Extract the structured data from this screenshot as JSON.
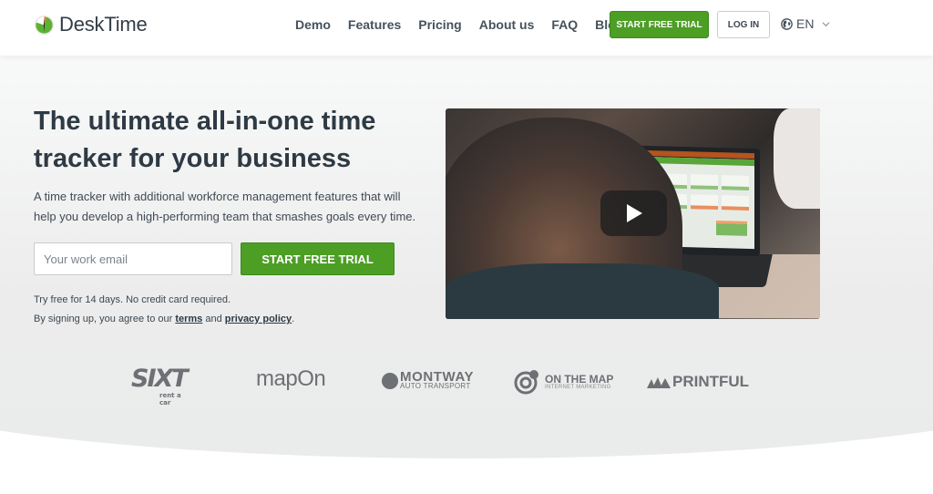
{
  "header": {
    "logo_text": "DeskTime",
    "nav": [
      {
        "label": "Demo"
      },
      {
        "label": "Features"
      },
      {
        "label": "Pricing"
      },
      {
        "label": "About us"
      },
      {
        "label": "FAQ"
      },
      {
        "label": "Blog"
      }
    ],
    "start_trial_label": "START FREE TRIAL",
    "login_label": "LOG IN",
    "language": "EN"
  },
  "hero": {
    "title": "The ultimate all-in-one time tracker for your business",
    "subtitle": "A time tracker with additional workforce management features that will help you develop a high-performing team that smashes goals every time.",
    "email_placeholder": "Your work email",
    "email_value": "",
    "cta_label": "START FREE TRIAL",
    "note_trial": "Try free for 14 days. No credit card required.",
    "note_agree_prefix": "By signing up, you agree to our ",
    "terms_label": "terms",
    "note_and": " and ",
    "privacy_label": "privacy policy",
    "note_end": "."
  },
  "video": {
    "play_icon": "play-icon"
  },
  "clients": {
    "sixt": "SIXT",
    "sixt_sub": "rent a car",
    "mapon": "mapOn",
    "montway": "MONTWAY",
    "montway_sub": "AUTO TRANSPORT",
    "onthemap": "ON THE MAP",
    "onthemap_sub": "INTERNET MARKETING",
    "printful": "PRINTFUL"
  },
  "colors": {
    "brand_green": "#4c9e25",
    "text_dark": "#2e3a44"
  }
}
